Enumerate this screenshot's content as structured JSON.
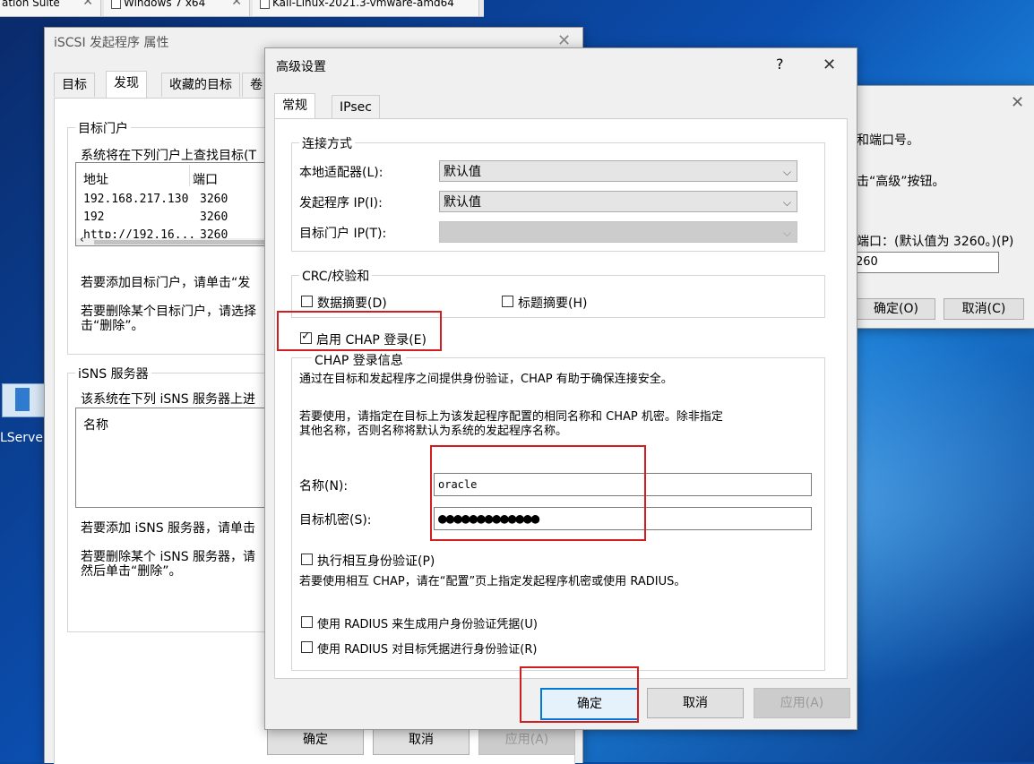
{
  "vm_tabs": [
    {
      "label": "ation Suite"
    },
    {
      "label": "Windows 7 x64"
    },
    {
      "label": "Kali-Linux-2021.3-vmware-amd64"
    }
  ],
  "desktop": {
    "icon_label": "LServe"
  },
  "iscsi": {
    "title": "iSCSI 发起程序 属性",
    "tabs": [
      "目标",
      "发现",
      "收藏的目标",
      "卷"
    ],
    "target_portals": {
      "legend": "目标门户",
      "desc": "系统将在下列门户上查找目标(T",
      "columns": [
        "地址",
        "端口"
      ],
      "rows": [
        {
          "address": "192.168.217.130",
          "port": "3260"
        },
        {
          "address": "192",
          "port": "3260"
        },
        {
          "address": "http://192.16...",
          "port": "3260"
        }
      ],
      "add_hint": "若要添加目标门户，请单击“发",
      "remove_hint_1": "若要删除某个目标门户，请选择",
      "remove_hint_2": "击“删除”。"
    },
    "isns": {
      "legend": "iSNS 服务器",
      "desc": "该系统在下列 iSNS 服务器上进",
      "column": "名称",
      "add_hint": "若要添加 iSNS 服务器，请单击",
      "remove_hint_1": "若要删除某个 iSNS 服务器，请",
      "remove_hint_2": "然后单击“删除”。"
    },
    "buttons": {
      "ok": "确定",
      "cancel": "取消",
      "apply": "应用(A)"
    }
  },
  "portal_dialog": {
    "line1": "和端口号。",
    "line2": "击“高级”按钮。",
    "line3": "端口：(默认值为 3260。)(P)",
    "port_value": "260",
    "ok": "确定(O)",
    "cancel": "取消(C)"
  },
  "advanced": {
    "title": "高级设置",
    "help": "?",
    "tabs": [
      "常规",
      "IPsec"
    ],
    "connect": {
      "legend": "连接方式",
      "local_adapter_label": "本地适配器(L):",
      "local_adapter_value": "默认值",
      "initiator_ip_label": "发起程序 IP(I):",
      "initiator_ip_value": "默认值",
      "target_portal_ip_label": "目标门户 IP(T):"
    },
    "crc": {
      "legend": "CRC/校验和",
      "data_digest": "数据摘要(D)",
      "header_digest": "标题摘要(H)"
    },
    "chap": {
      "enable_label": "启用 CHAP 登录(E)",
      "enable_checked": true,
      "legend": "CHAP 登录信息",
      "desc1": "通过在目标和发起程序之间提供身份验证，CHAP 有助于确保连接安全。",
      "desc2_1": "若要使用，请指定在目标上为该发起程序配置的相同名称和 CHAP 机密。除非指定",
      "desc2_2": "其他名称，否则名称将默认为系统的发起程序名称。",
      "name_label": "名称(N):",
      "name_value": "oracle",
      "secret_label": "目标机密(S):",
      "secret_value": "●●●●●●●●●●●●●",
      "mutual_label": "执行相互身份验证(P)",
      "mutual_hint": "若要使用相互 CHAP，请在“配置”页上指定发起程序机密或使用 RADIUS。",
      "radius_gen": "使用 RADIUS 来生成用户身份验证凭据(U)",
      "radius_auth": "使用 RADIUS 对目标凭据进行身份验证(R)"
    },
    "buttons": {
      "ok": "确定",
      "cancel": "取消",
      "apply": "应用(A)"
    }
  }
}
